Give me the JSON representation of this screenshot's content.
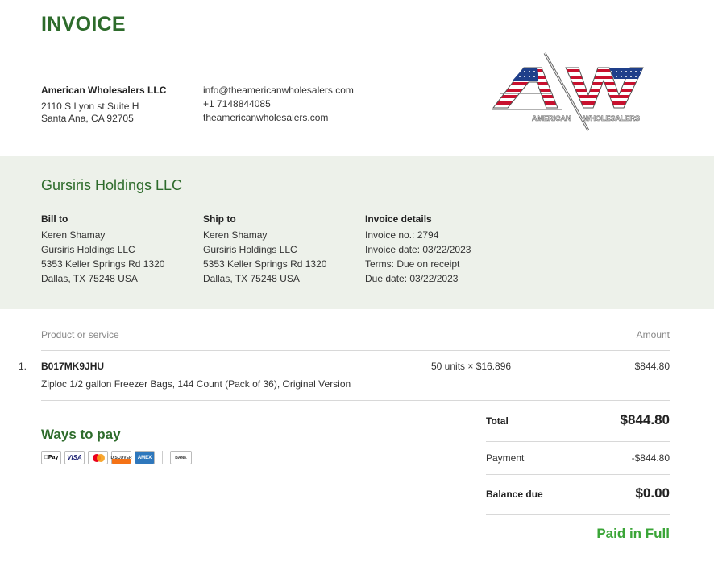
{
  "invoice": {
    "title": "INVOICE",
    "seller": {
      "name": "American Wholesalers LLC",
      "address_line1": "2110 S Lyon st Suite H",
      "address_line2": "Santa Ana, CA 92705",
      "email": "info@theamericanwholesalers.com",
      "phone": "+1 7148844085",
      "website": "theamericanwholesalers.com"
    },
    "logo": {
      "letters": "AW",
      "caption_left": "AMERICAN",
      "caption_right": "WHOLESALERS",
      "colors": {
        "red": "#c8102e",
        "blue": "#1f3f8a",
        "white": "#ffffff"
      }
    },
    "customer_name": "Gursiris Holdings LLC",
    "bill_to": {
      "heading": "Bill to",
      "lines": [
        "Keren Shamay",
        "Gursiris Holdings LLC",
        "5353 Keller Springs Rd 1320",
        "Dallas, TX 75248 USA"
      ]
    },
    "ship_to": {
      "heading": "Ship to",
      "lines": [
        "Keren Shamay",
        "Gursiris Holdings LLC",
        "5353 Keller Springs Rd 1320",
        "Dallas, TX 75248 USA"
      ]
    },
    "details": {
      "heading": "Invoice details",
      "lines": [
        "Invoice no.: 2794",
        "Invoice date: 03/22/2023",
        "Terms: Due on receipt",
        "Due date: 03/22/2023"
      ]
    },
    "table": {
      "col_product": "Product or service",
      "col_amount": "Amount",
      "items": [
        {
          "num": "1.",
          "sku": "B017MK9JHU",
          "description": "Ziploc 1/2 gallon Freezer Bags, 144 Count (Pack of 36), Original Version",
          "qty": "50 units × $16.896",
          "amount": "$844.80"
        }
      ]
    },
    "payment_methods": {
      "heading": "Ways to pay",
      "icons": [
        "apple-pay",
        "visa",
        "mastercard",
        "discover",
        "amex",
        "bank"
      ],
      "apple_label": "Pay",
      "visa_label": "VISA",
      "discover_label": "DISCOVER",
      "amex_label": "AMEX",
      "bank_label": "BANK"
    },
    "totals": {
      "total_label": "Total",
      "total_value": "$844.80",
      "payment_label": "Payment",
      "payment_value": "-$844.80",
      "balance_label": "Balance due",
      "balance_value": "$0.00",
      "status": "Paid in Full"
    },
    "colors": {
      "brand_green": "#2d6b2b",
      "paid_green": "#3aa537",
      "band_bg": "#edf1ea"
    }
  }
}
